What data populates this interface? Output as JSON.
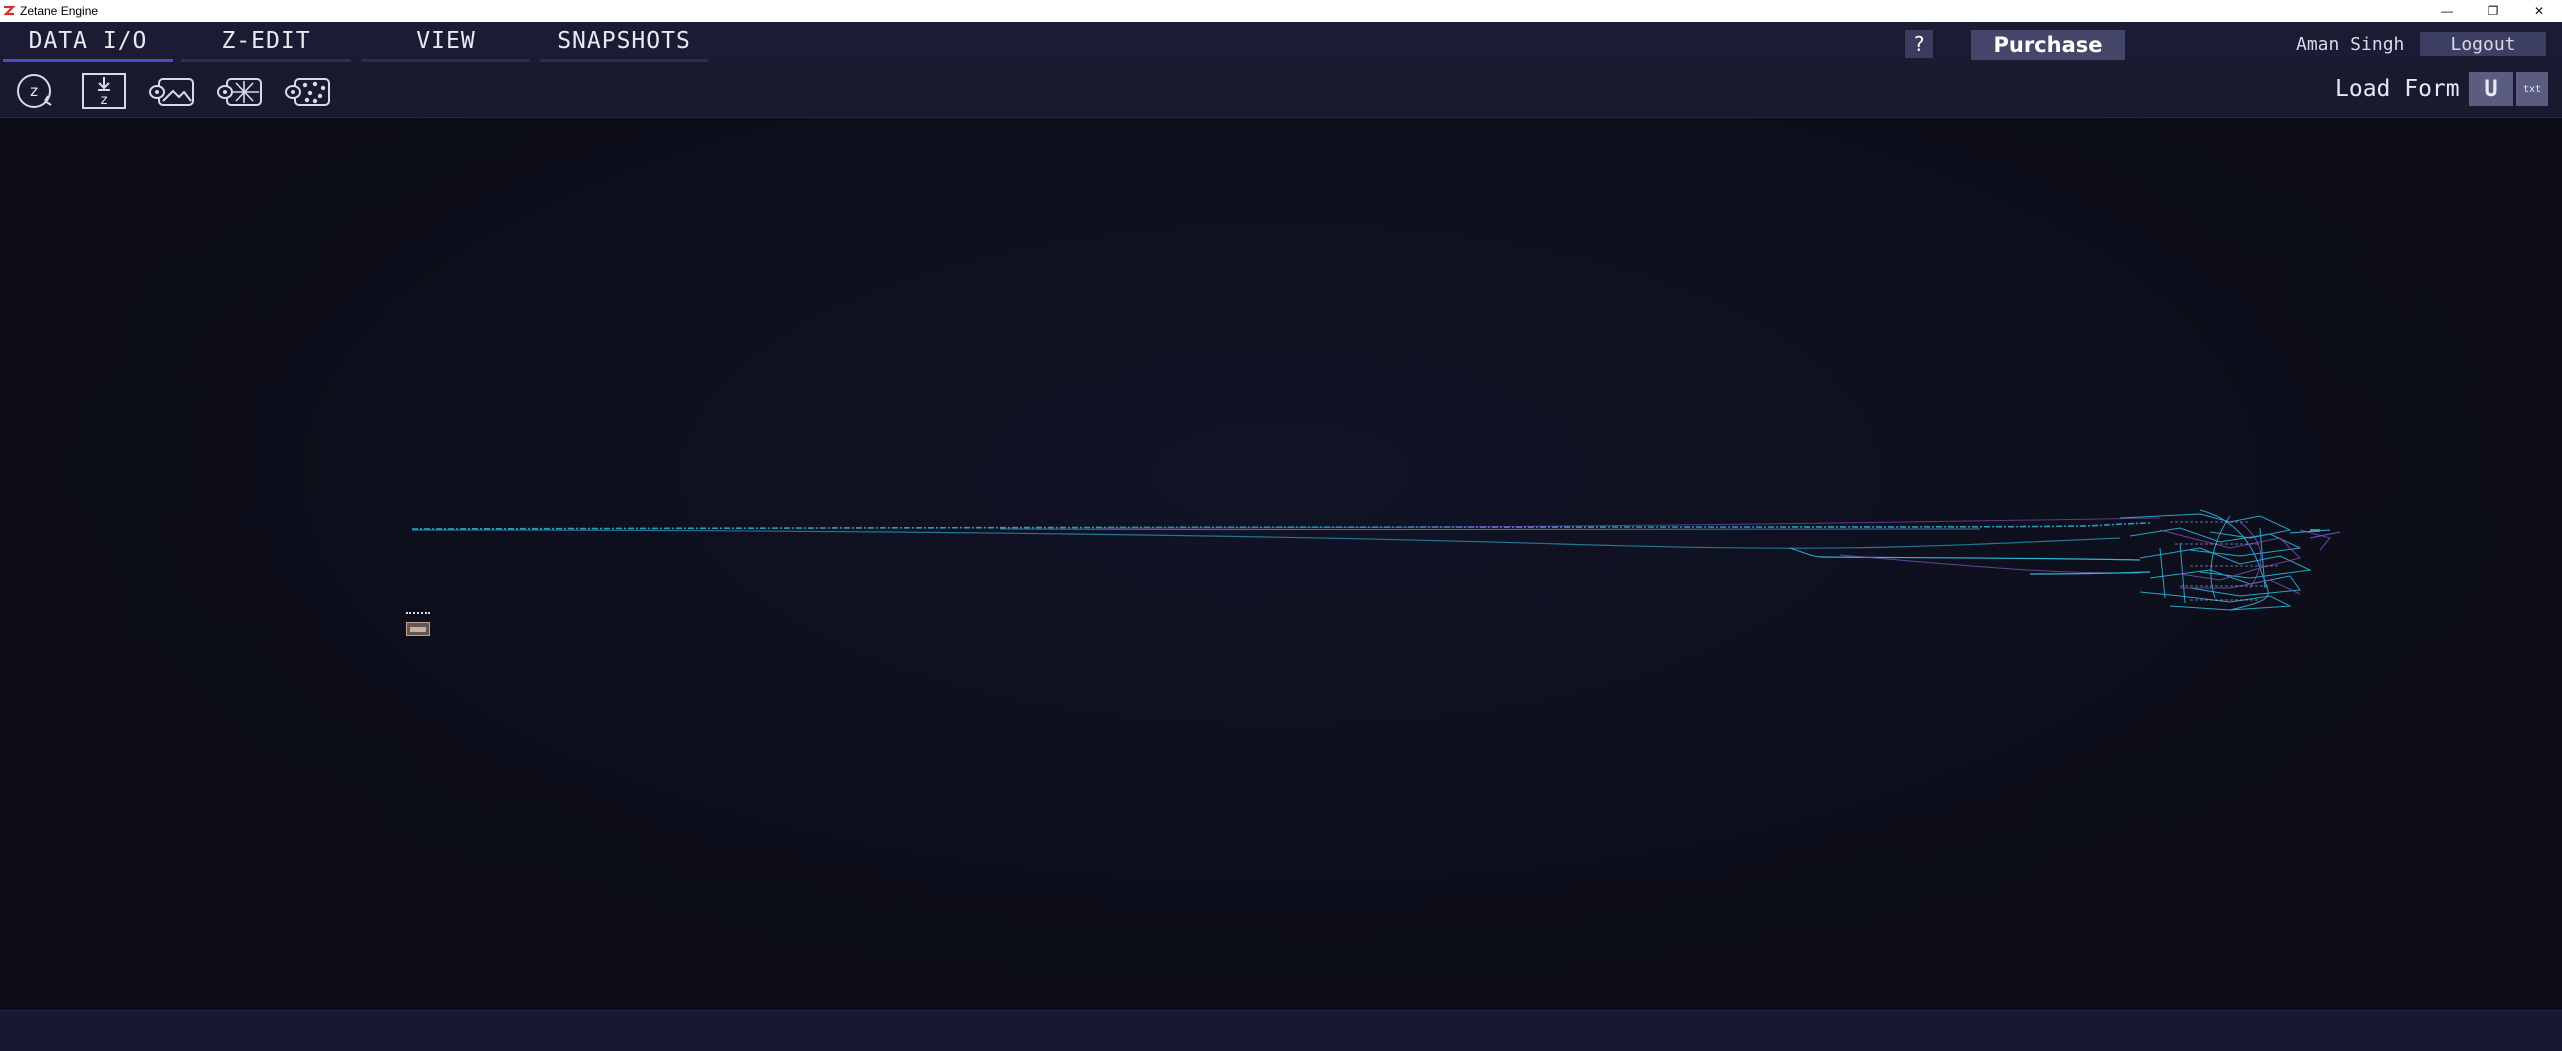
{
  "window": {
    "title": "Zetane Engine",
    "controls": [
      "minimize-icon",
      "restore-icon",
      "close-icon"
    ]
  },
  "menu": {
    "tabs": [
      {
        "label": "DATA I/O",
        "active": true
      },
      {
        "label": "Z-EDIT",
        "active": false
      },
      {
        "label": "VIEW",
        "active": false
      },
      {
        "label": "SNAPSHOTS",
        "active": false
      }
    ],
    "help_label": "?",
    "purchase_label": "Purchase",
    "user_name": "Aman Singh",
    "logout_label": "Logout"
  },
  "toolbar": {
    "tools": [
      {
        "icon": "z-reload-icon"
      },
      {
        "icon": "z-download-icon"
      },
      {
        "icon": "load-image-icon"
      },
      {
        "icon": "load-spark-icon"
      },
      {
        "icon": "load-points-icon"
      }
    ],
    "load_form_label": "Load Form",
    "upload_label": "U",
    "txt_label": "txt"
  },
  "canvas": {
    "icon": "node-graph-icon",
    "thumbnail_icon": "image-thumbnail-icon"
  },
  "colors": {
    "background": "#0d0e1a",
    "menubar": "#1b1c33",
    "accent": "#4c4fc4",
    "graph_line_cyan": "#2bb6d6",
    "graph_line_purple": "#7a4fb8"
  }
}
